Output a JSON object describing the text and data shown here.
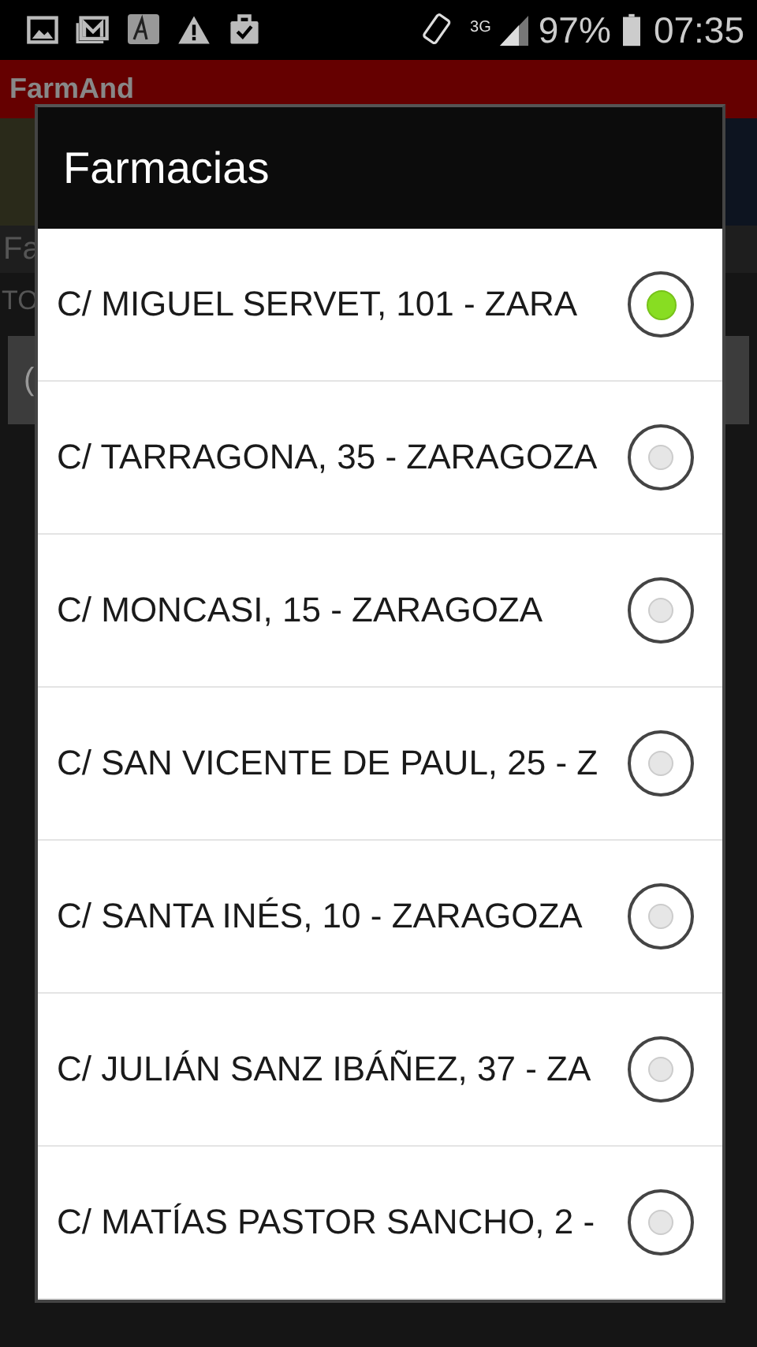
{
  "status_bar": {
    "network": "3G",
    "battery": "97%",
    "time": "07:35"
  },
  "app": {
    "title": "FarmAnd",
    "background_texts": [
      "Fa",
      "TO",
      "("
    ]
  },
  "dialog": {
    "title": "Farmacias",
    "items": [
      {
        "label": "C/ MIGUEL SERVET, 101 - ZARA",
        "selected": true
      },
      {
        "label": "C/ TARRAGONA, 35 - ZARAGOZA",
        "selected": false
      },
      {
        "label": "C/ MONCASI, 15 - ZARAGOZA",
        "selected": false
      },
      {
        "label": "C/ SAN VICENTE DE PAUL, 25 - Z",
        "selected": false
      },
      {
        "label": "C/ SANTA INÉS, 10 - ZARAGOZA",
        "selected": false
      },
      {
        "label": "C/ JULIÁN SANZ IBÁÑEZ, 37 - ZA",
        "selected": false
      },
      {
        "label": "C/ MATÍAS PASTOR SANCHO, 2 -",
        "selected": false
      }
    ]
  }
}
